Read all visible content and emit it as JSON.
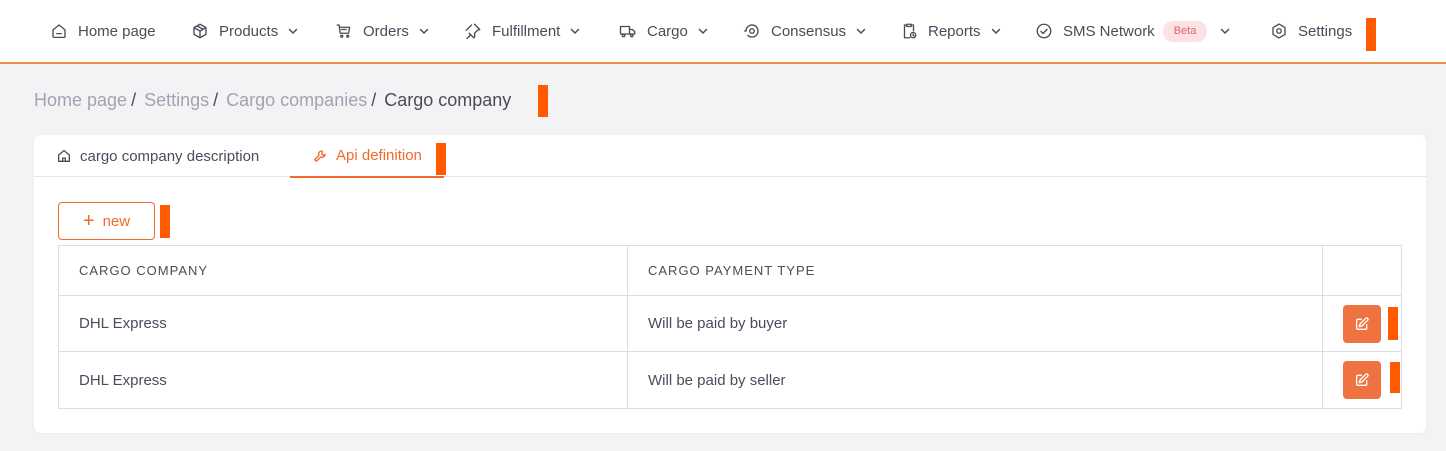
{
  "nav": {
    "items": [
      {
        "label": "Home page",
        "icon": "home-icon",
        "has_dropdown": false
      },
      {
        "label": "Products",
        "icon": "box-icon",
        "has_dropdown": true
      },
      {
        "label": "Orders",
        "icon": "cart-icon",
        "has_dropdown": true
      },
      {
        "label": "Fulfillment",
        "icon": "pin-icon",
        "has_dropdown": true
      },
      {
        "label": "Cargo",
        "icon": "truck-icon",
        "has_dropdown": true
      },
      {
        "label": "Consensus",
        "icon": "eye-icon",
        "has_dropdown": true
      },
      {
        "label": "Reports",
        "icon": "report-icon",
        "has_dropdown": true
      },
      {
        "label": "SMS Network",
        "icon": "check-circle-icon",
        "has_dropdown": true,
        "badge": "Beta"
      },
      {
        "label": "Settings",
        "icon": "gear-icon",
        "has_dropdown": false
      }
    ]
  },
  "breadcrumb": {
    "items": [
      "Home page",
      "Settings",
      "Cargo companies"
    ],
    "current": "Cargo company"
  },
  "tabs": [
    {
      "label": "cargo company description",
      "icon": "home-icon",
      "active": false
    },
    {
      "label": "Api definition",
      "icon": "wrench-icon",
      "active": true
    }
  ],
  "new_button": {
    "label": "new",
    "icon": "plus-icon"
  },
  "table": {
    "headers": [
      "CARGO COMPANY",
      "CARGO PAYMENT TYPE",
      ""
    ],
    "rows": [
      {
        "company": "DHL Express",
        "payment_type": "Will be paid by buyer"
      },
      {
        "company": "DHL Express",
        "payment_type": "Will be paid by seller"
      }
    ]
  },
  "colors": {
    "accent": "#f06a2a",
    "nav_border": "#f08a4b",
    "edit_button": "#ee7340",
    "marker": "#ff5a00",
    "badge_bg": "#fde2e4",
    "badge_text": "#e0626f"
  }
}
